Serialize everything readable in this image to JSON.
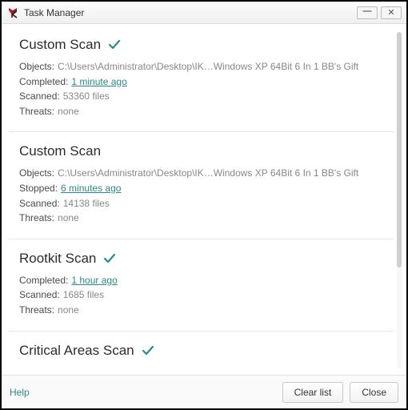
{
  "window": {
    "title": "Task Manager"
  },
  "tasks": [
    {
      "title": "Custom Scan",
      "completed": true,
      "rows": [
        {
          "label": "Objects:",
          "value": "C:\\Users\\Administrator\\Desktop\\IK…Windows XP 64Bit 6 In 1 BB's Gift"
        },
        {
          "label": "Completed:",
          "link": "1 minute ago"
        },
        {
          "label": "Scanned:",
          "value": "53360 files"
        },
        {
          "label": "Threats:",
          "value": "none"
        }
      ]
    },
    {
      "title": "Custom Scan",
      "completed": false,
      "rows": [
        {
          "label": "Objects:",
          "value": "C:\\Users\\Administrator\\Desktop\\IK…Windows XP 64Bit 6 In 1 BB's Gift"
        },
        {
          "label": "Stopped:",
          "link": "6 minutes ago"
        },
        {
          "label": "Scanned:",
          "value": "14138 files"
        },
        {
          "label": "Threats:",
          "value": "none"
        }
      ]
    },
    {
      "title": "Rootkit Scan",
      "completed": true,
      "rows": [
        {
          "label": "Completed:",
          "link": "1 hour ago"
        },
        {
          "label": "Scanned:",
          "value": "1685 files"
        },
        {
          "label": "Threats:",
          "value": "none"
        }
      ]
    },
    {
      "title": "Critical Areas Scan",
      "completed": true,
      "rows": []
    }
  ],
  "footer": {
    "help": "Help",
    "clear": "Clear list",
    "close": "Close"
  },
  "colors": {
    "accent": "#2a8a84"
  }
}
